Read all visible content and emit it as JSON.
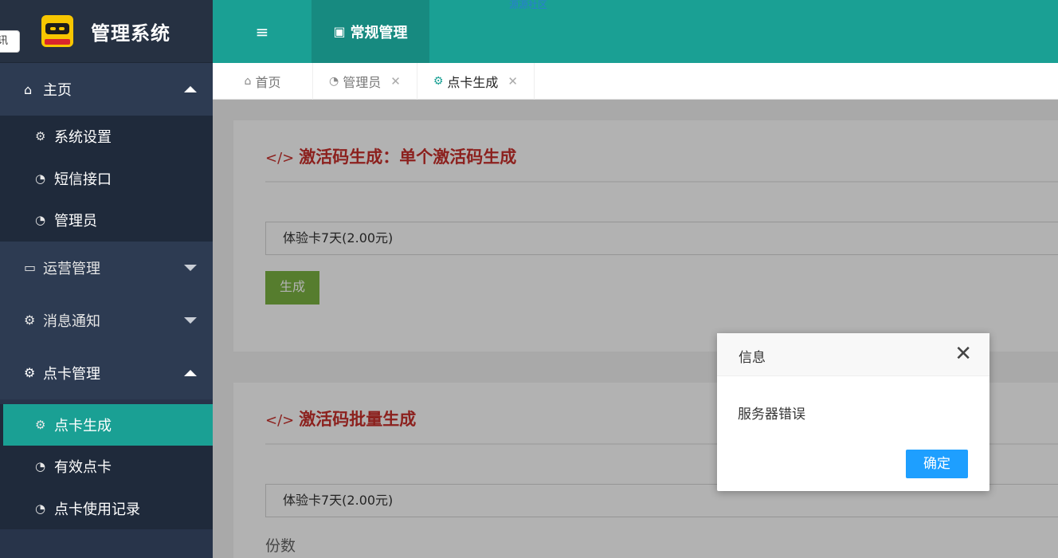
{
  "app": {
    "title": "管理系统",
    "tooltip": "讯"
  },
  "header": {
    "menu_icon": "≡",
    "tab_label": "常规管理",
    "watermark": "源源社区"
  },
  "sidebar": {
    "home": {
      "label": "主页",
      "items": [
        "系统设置",
        "短信接口",
        "管理员"
      ]
    },
    "ops": {
      "label": "运营管理"
    },
    "notify": {
      "label": "消息通知"
    },
    "card": {
      "label": "点卡管理",
      "items": [
        "点卡生成",
        "有效点卡",
        "点卡使用记录"
      ]
    }
  },
  "tabs": [
    {
      "label": "首页"
    },
    {
      "label": "管理员"
    },
    {
      "label": "点卡生成"
    }
  ],
  "close_glyph": "✕",
  "main": {
    "card1": {
      "title": "激活码生成：单个激活码生成",
      "select_value": "体验卡7天(2.00元)",
      "button": "生成"
    },
    "card2": {
      "title": "激活码批量生成",
      "select_value": "体验卡7天(2.00元)",
      "count_label": "份数"
    }
  },
  "dialog": {
    "title": "信息",
    "message": "服务器错误",
    "ok": "确定",
    "close": "✕"
  },
  "colors": {
    "accent": "#1aa094",
    "sidebar": "#28344a",
    "title_red": "#c9302c",
    "generate_green": "#7cb342",
    "ok_blue": "#1e9fff"
  }
}
